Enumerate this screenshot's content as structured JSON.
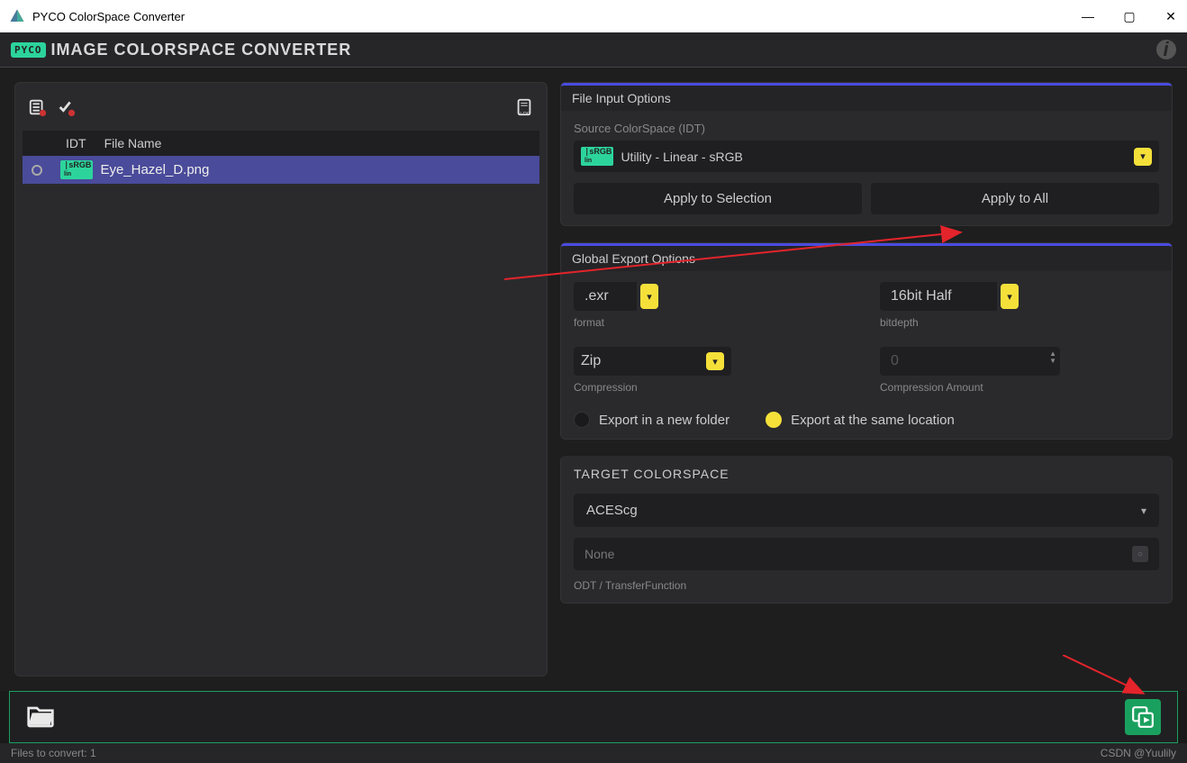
{
  "window": {
    "title": "PYCO ColorSpace Converter"
  },
  "appbar": {
    "logo": "PYCO",
    "title": "IMAGE COLORSPACE CONVERTER"
  },
  "filelist": {
    "header_idt": "IDT",
    "header_filename": "File Name",
    "rows": [
      {
        "idt_tag_top": "sRGB",
        "idt_tag_bottom": "lin",
        "filename": "Eye_Hazel_D.png"
      }
    ]
  },
  "file_input": {
    "header": "File Input Options",
    "source_label": "Source ColorSpace (IDT)",
    "source_value": "Utility - Linear - sRGB",
    "source_tag_top": "sRGB",
    "source_tag_bottom": "lin",
    "apply_selection": "Apply to Selection",
    "apply_all": "Apply to All"
  },
  "global_export": {
    "header": "Global Export Options",
    "format_value": ".exr",
    "format_label": "format",
    "bitdepth_value": "16bit Half",
    "bitdepth_label": "bitdepth",
    "compression_value": "Zip",
    "compression_label": "Compression",
    "compression_amount_value": "0",
    "compression_amount_label": "Compression Amount",
    "export_new_folder": "Export in a new folder",
    "export_same_location": "Export at the same location"
  },
  "target": {
    "header": "TARGET COLORSPACE",
    "value": "ACEScg",
    "odt_value": "None",
    "odt_label": "ODT / TransferFunction"
  },
  "status": {
    "files": "Files to convert: 1",
    "watermark": "CSDN @Yuulily"
  }
}
